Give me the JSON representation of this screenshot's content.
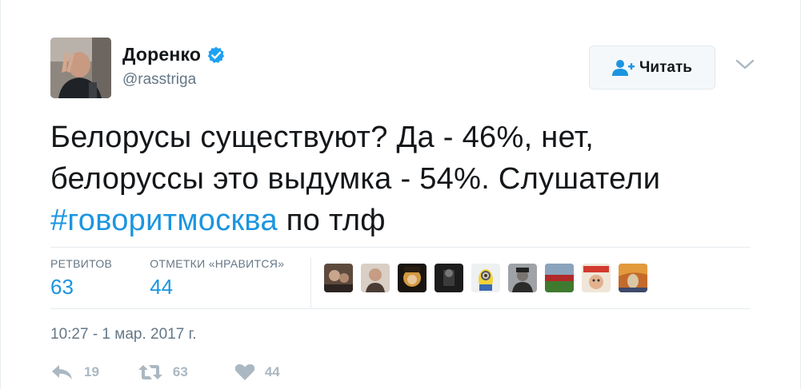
{
  "author": {
    "name": "Доренко",
    "handle": "@rasstriga",
    "verified": true
  },
  "follow_button": {
    "label": "Читать",
    "icon": "add-user-icon"
  },
  "menu_icon": "chevron-down-icon",
  "tweet": {
    "lines": [
      "Белорусы существуют? Да - 46%, нет,",
      "белоруссы это выдумка - 54%. Слушатели"
    ],
    "hashtag": "#говоритмосква",
    "tail": " по тлф"
  },
  "stats": {
    "retweets_label": "РЕТВИТОВ",
    "retweets_count": "63",
    "likes_label": "ОТМЕТКИ «НРАВИТСЯ»",
    "likes_count": "44"
  },
  "timestamp": "10:27 - 1 мар. 2017 г.",
  "actions": {
    "reply_count": "19",
    "retweet_count": "63",
    "like_count": "44"
  },
  "colors": {
    "link": "#1b95e0",
    "muted": "#657786",
    "action": "#aab8c2",
    "verified": "#1da1f2"
  }
}
